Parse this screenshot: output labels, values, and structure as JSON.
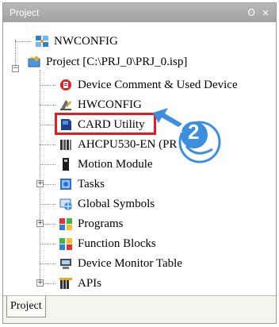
{
  "panel": {
    "title": "Project",
    "pin_glyph": "ʘ",
    "close_glyph": "×"
  },
  "tree": {
    "root1": "NWCONFIG",
    "root2": "Project [C:\\PRJ_0\\PRJ_0.isp]",
    "items": [
      "Device Comment & Used Device",
      "HWCONFIG",
      "CARD Utility",
      "AHCPU530-EN  (PR",
      "Motion Module",
      "Tasks",
      "Global Symbols",
      "Programs",
      "Function Blocks",
      "Device Monitor Table",
      "APIs"
    ]
  },
  "tabs": {
    "active": "Project"
  },
  "annotation": {
    "step_number": "2",
    "highlight_color": "#e31b23",
    "arrow_color": "#3e8ede"
  }
}
